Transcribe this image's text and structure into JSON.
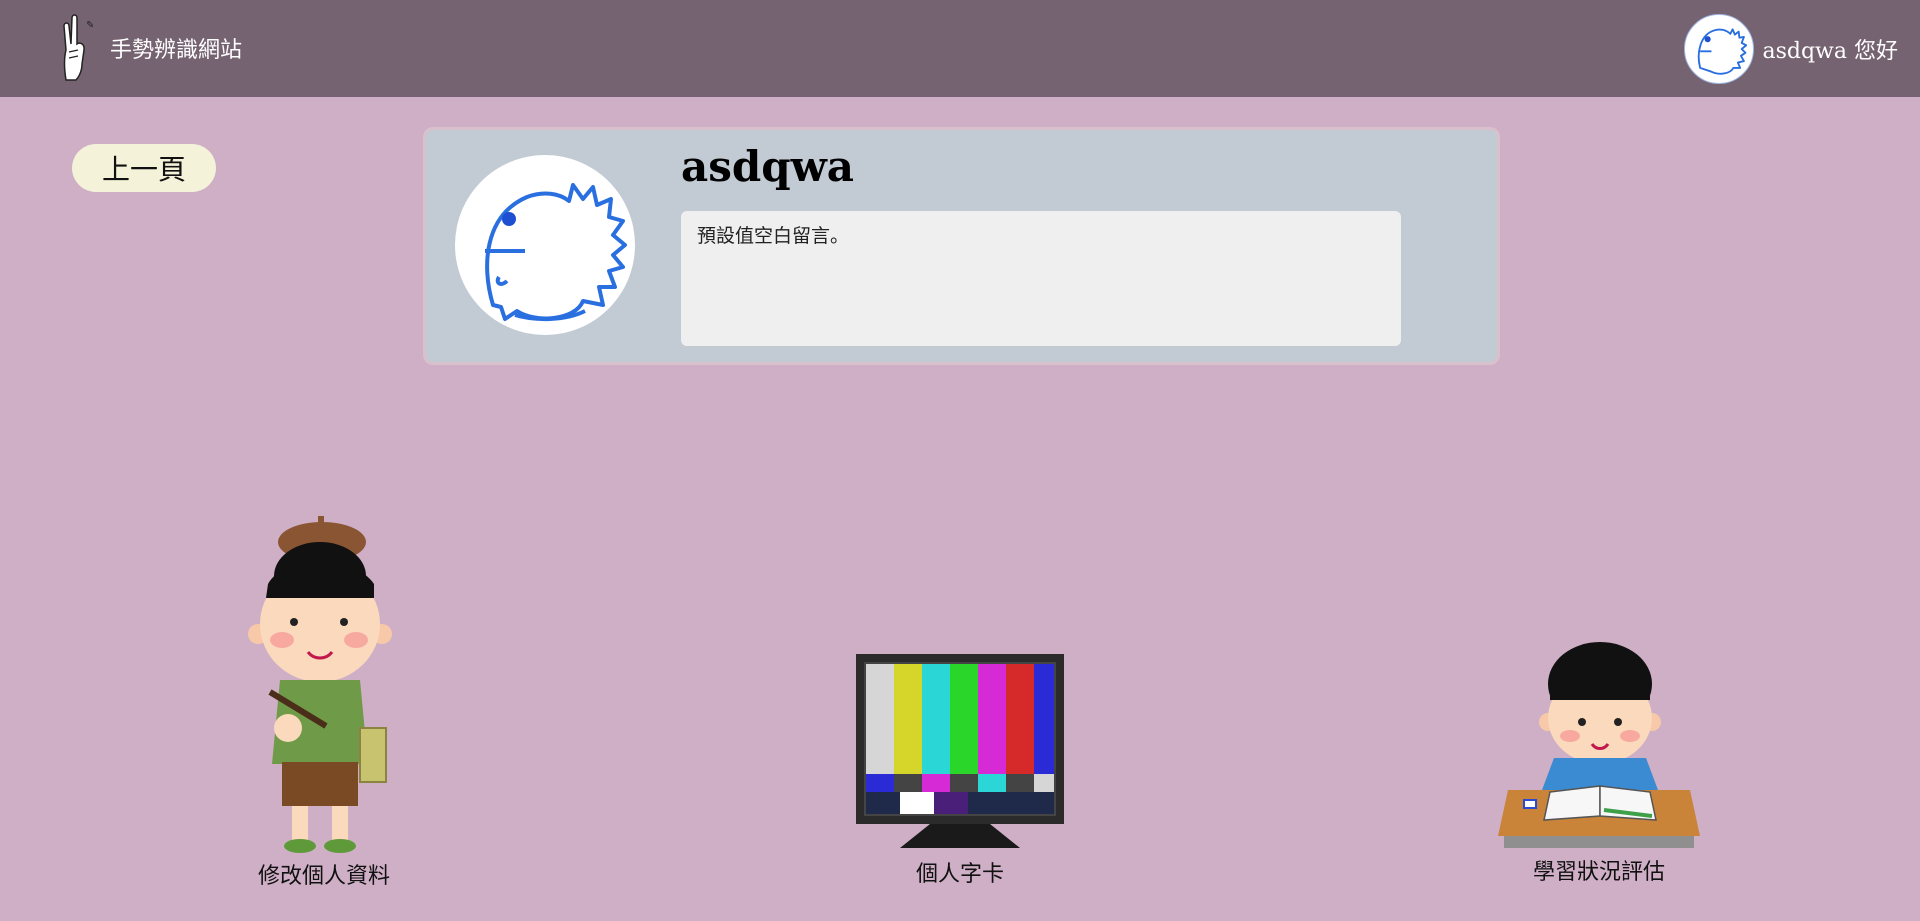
{
  "header": {
    "site_title": "手勢辨識網站",
    "user_greeting": "asdqwa 您好",
    "bg_color": "#766371"
  },
  "back_button": {
    "label": "上一頁"
  },
  "profile": {
    "name": "asdqwa",
    "message": "預設值空白留言。",
    "avatar_icon": "dinosaur-doodle-icon"
  },
  "features": [
    {
      "label": "修改個人資料",
      "icon": "artist-boy-illustration"
    },
    {
      "label": "個人字卡",
      "icon": "tv-color-bars-illustration"
    },
    {
      "label": "學習狀況評估",
      "icon": "studying-boy-illustration"
    }
  ],
  "colors": {
    "page_bg": "#cfafc6",
    "card_bg": "#c2cad4",
    "back_button_bg": "#f4f2d8"
  }
}
